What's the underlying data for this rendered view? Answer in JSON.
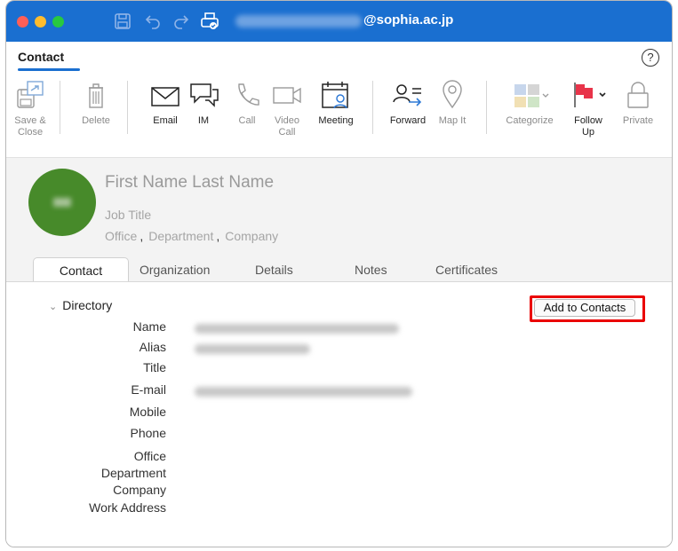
{
  "titlebar": {
    "title_suffix": "@sophia.ac.jp"
  },
  "ribbon_tab": {
    "label": "Contact"
  },
  "help": {
    "label": "?"
  },
  "ribbon": {
    "save_close": "Save &\nClose",
    "delete": "Delete",
    "email": "Email",
    "im": "IM",
    "call": "Call",
    "video_call": "Video\nCall",
    "meeting": "Meeting",
    "forward": "Forward",
    "map_it": "Map It",
    "categorize": "Categorize",
    "follow_up": "Follow\nUp",
    "private": "Private"
  },
  "header": {
    "name_placeholder": "First Name Last Name",
    "job_title_placeholder": "Job Title",
    "office_placeholder": "Office",
    "department_placeholder": "Department",
    "company_placeholder": "Company",
    "separator": ","
  },
  "tabs": [
    "Contact",
    "Organization",
    "Details",
    "Notes",
    "Certificates"
  ],
  "directory": {
    "section_label": "Directory",
    "add_button": "Add to Contacts",
    "fields": [
      "Name",
      "Alias",
      "Title",
      "E-mail",
      "Mobile",
      "Phone",
      "Office",
      "Department",
      "Company",
      "Work Address"
    ]
  },
  "colors": {
    "titlebar": "#1a6fd0",
    "avatar": "#478a2a",
    "flag": "#e8344a",
    "highlight": "#ea0000"
  }
}
